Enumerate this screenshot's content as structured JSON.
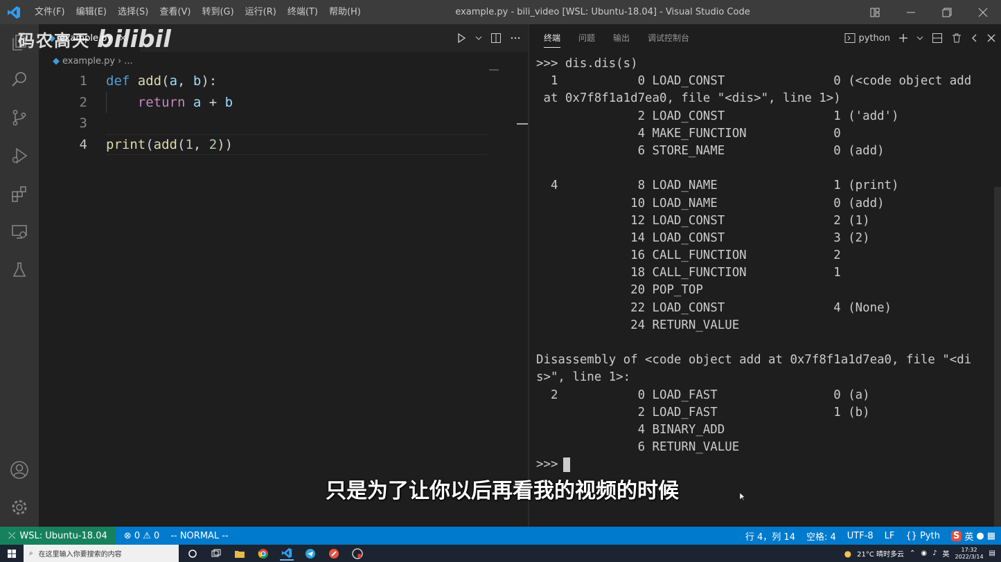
{
  "window": {
    "title": "example.py - bili_video [WSL: Ubuntu-18.04] - Visual Studio Code",
    "menu": [
      "文件(F)",
      "编辑(E)",
      "选择(S)",
      "查看(V)",
      "转到(G)",
      "运行(R)",
      "终端(T)",
      "帮助(H)"
    ]
  },
  "editor": {
    "tab_label": "example.py",
    "breadcrumb": [
      "example.py",
      "..."
    ],
    "lines": [
      {
        "num": "1",
        "tokens": [
          [
            "kw",
            "def"
          ],
          [
            "",
            " "
          ],
          [
            "fn",
            "add"
          ],
          [
            "",
            "("
          ],
          [
            "var",
            "a"
          ],
          [
            "",
            ", "
          ],
          [
            "var",
            "b"
          ],
          [
            "",
            "):"
          ]
        ]
      },
      {
        "num": "2",
        "tokens": [
          [
            "",
            "    "
          ],
          [
            "kw2",
            "return"
          ],
          [
            "",
            " "
          ],
          [
            "var",
            "a"
          ],
          [
            "",
            " + "
          ],
          [
            "var",
            "b"
          ]
        ]
      },
      {
        "num": "3",
        "tokens": []
      },
      {
        "num": "4",
        "tokens": [
          [
            "fn",
            "print"
          ],
          [
            "",
            "("
          ],
          [
            "fn",
            "add"
          ],
          [
            "",
            "("
          ],
          [
            "num",
            "1"
          ],
          [
            "",
            ", "
          ],
          [
            "num",
            "2"
          ],
          [
            "",
            "))"
          ]
        ]
      }
    ]
  },
  "panel": {
    "tabs": [
      "终端",
      "问题",
      "输出",
      "调试控制台"
    ],
    "active_tab": "终端",
    "shell_label": "python",
    "terminal_lines": [
      ">>> dis.dis(s)",
      "  1           0 LOAD_CONST               0 (<code object add",
      " at 0x7f8f1a1d7ea0, file \"<dis>\", line 1>)",
      "              2 LOAD_CONST               1 ('add')",
      "              4 MAKE_FUNCTION            0",
      "              6 STORE_NAME               0 (add)",
      "",
      "  4           8 LOAD_NAME                1 (print)",
      "             10 LOAD_NAME                0 (add)",
      "             12 LOAD_CONST               2 (1)",
      "             14 LOAD_CONST               3 (2)",
      "             16 CALL_FUNCTION            2",
      "             18 CALL_FUNCTION            1",
      "             20 POP_TOP",
      "             22 LOAD_CONST               4 (None)",
      "             24 RETURN_VALUE",
      "",
      "Disassembly of <code object add at 0x7f8f1a1d7ea0, file \"<di",
      "s>\", line 1>:",
      "  2           0 LOAD_FAST                0 (a)",
      "              2 LOAD_FAST                1 (b)",
      "              4 BINARY_ADD",
      "              6 RETURN_VALUE"
    ],
    "prompt": ">>>"
  },
  "overlay": {
    "watermark_text": "码农高天",
    "watermark_logo": "bilibili",
    "subtitle": "只是为了让你以后再看我的视频的时候"
  },
  "statusbar": {
    "remote": "WSL: Ubuntu-18.04",
    "errors": "0",
    "warnings": "0",
    "vim_mode": "-- NORMAL --",
    "position": "行 4，列 14",
    "spaces": "空格: 4",
    "encoding": "UTF-8",
    "eol": "LF",
    "language": "Pyth"
  },
  "taskbar": {
    "search_placeholder": "在这里输入你要搜索的内容",
    "weather": "21°C 晴时多云",
    "ime": "英",
    "time": "17:32",
    "date": "2022/3/14"
  },
  "colors": {
    "statusbar": "#007acc",
    "remote": "#16825d",
    "titlebar": "#3c3c3c",
    "activitybar": "#333333",
    "editor_bg": "#1e1e1e"
  }
}
